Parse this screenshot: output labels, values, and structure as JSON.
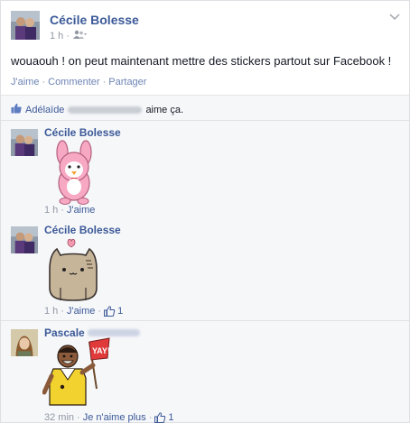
{
  "post": {
    "author": "Cécile Bolesse",
    "time": "1 h",
    "privacy_icon": "friends-icon",
    "menu_icon": "chevron-down-icon",
    "status_text": "wouaouh ! on peut maintenant mettre des stickers partout sur Facebook !",
    "actions": {
      "like": "J'aime",
      "separator": "·",
      "comment": "Commenter",
      "share": "Partager"
    }
  },
  "likes": {
    "name": "Adélaïde",
    "suffix": "aime ça.",
    "icon": "thumbs-up-icon"
  },
  "comments": [
    {
      "author": "Cécile Bolesse",
      "time": "1 h",
      "like_label": "J'aime",
      "like_count": "",
      "sticker": "pink-bunny-sticker"
    },
    {
      "author": "Cécile Bolesse",
      "time": "1 h",
      "like_label": "J'aime",
      "like_count": "1",
      "sticker": "pusheen-cat-sticker"
    },
    {
      "author": "Pascale",
      "time": "32 min",
      "like_label": "Je n'aime plus",
      "like_count": "1",
      "sticker": "yay-referee-sticker",
      "flag_text": "YAY!"
    }
  ],
  "colors": {
    "link": "#3b5998",
    "meta": "#9197a3",
    "feedback_bg": "#f6f7f9"
  }
}
